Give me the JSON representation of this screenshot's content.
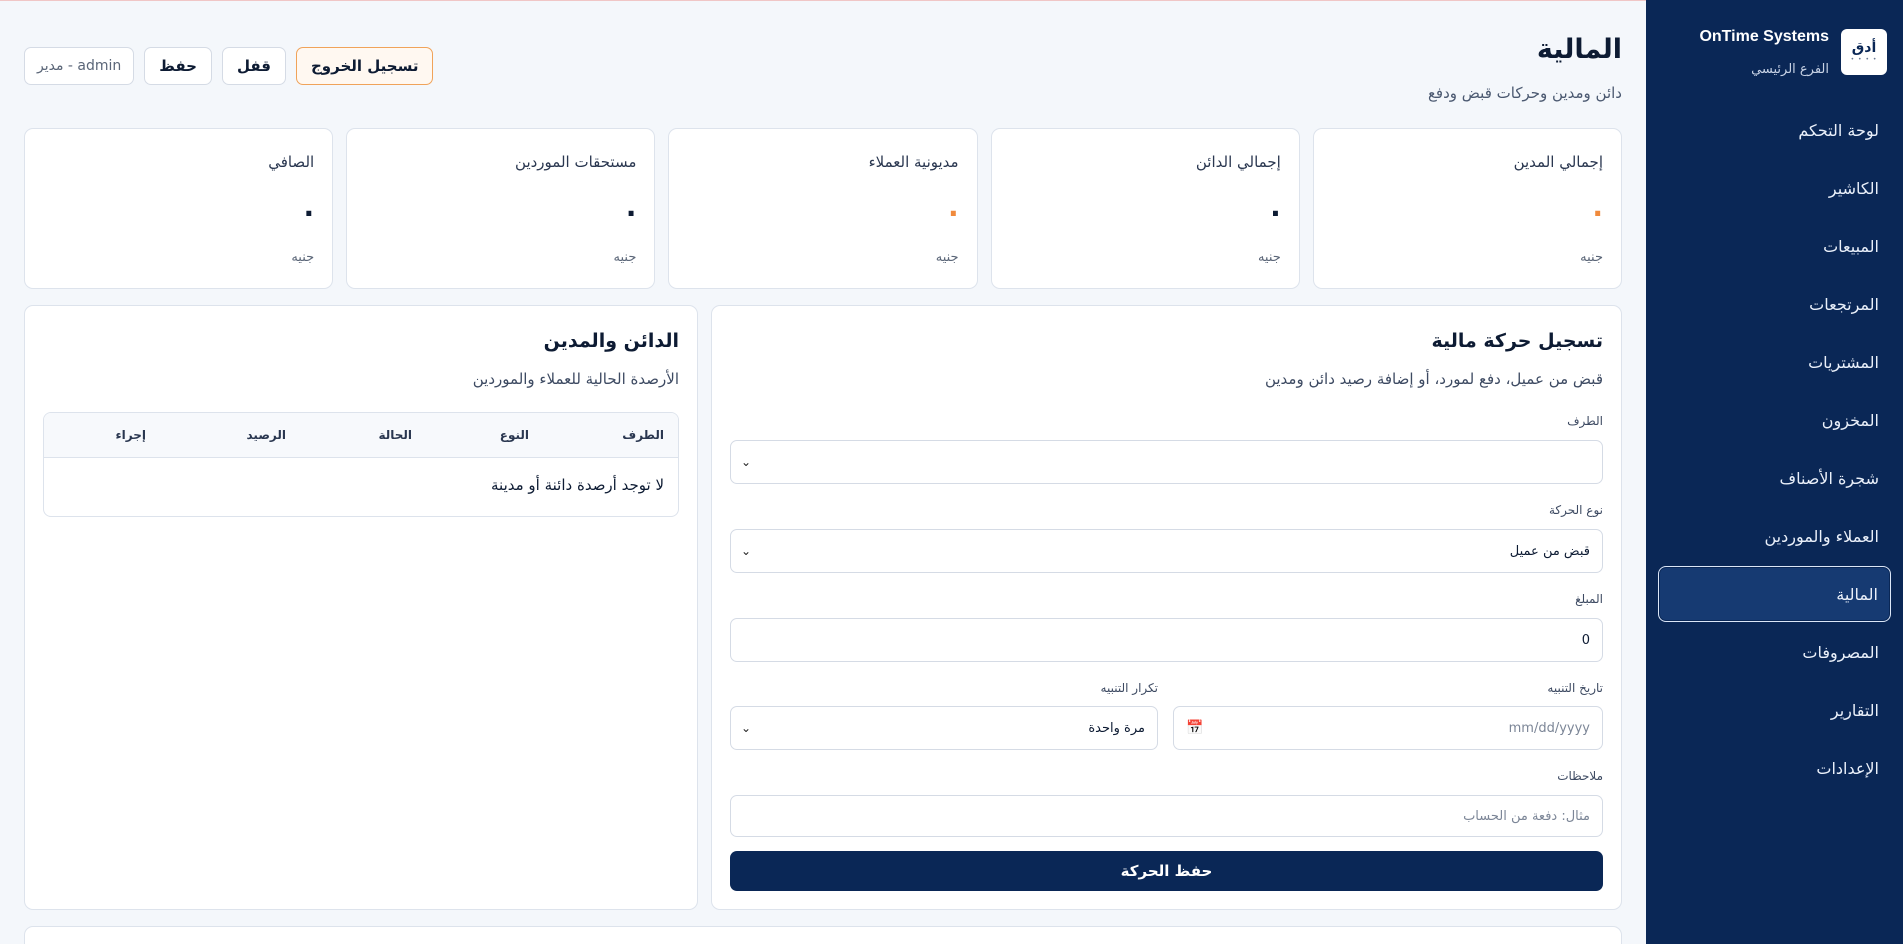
{
  "brand": {
    "name": "OnTime Systems",
    "branch": "الفرع الرئيسي",
    "logo_text": "أدق",
    "logo_dots": "• • • •"
  },
  "sidebar": {
    "items": [
      {
        "label": "لوحة التحكم"
      },
      {
        "label": "الكاشير"
      },
      {
        "label": "المبيعات"
      },
      {
        "label": "المرتجعات"
      },
      {
        "label": "المشتريات"
      },
      {
        "label": "المخزون"
      },
      {
        "label": "شجرة الأصناف"
      },
      {
        "label": "العملاء والموردين"
      },
      {
        "label": "المالية",
        "active": true
      },
      {
        "label": "المصروفات"
      },
      {
        "label": "التقارير"
      },
      {
        "label": "الإعدادات"
      }
    ]
  },
  "header": {
    "title": "المالية",
    "subtitle": "دائن ومدين وحركات قبض ودفع",
    "user": "admin - مدير",
    "save_label": "حفظ",
    "lock_label": "قفل",
    "logout_label": "تسجيل الخروج"
  },
  "stats": [
    {
      "label": "إجمالي المدين",
      "value": "·",
      "unit": "جنيه",
      "color": "#f08a3c"
    },
    {
      "label": "إجمالي الدائن",
      "value": "·",
      "unit": "جنيه",
      "color": "#0d1b33"
    },
    {
      "label": "مديونية العملاء",
      "value": "·",
      "unit": "جنيه",
      "color": "#f08a3c"
    },
    {
      "label": "مستحقات الموردين",
      "value": "·",
      "unit": "جنيه",
      "color": "#0d1b33"
    },
    {
      "label": "الصافي",
      "value": "·",
      "unit": "جنيه",
      "color": "#0d1b33"
    }
  ],
  "form": {
    "title": "تسجيل حركة مالية",
    "subtitle": "قبض من عميل، دفع لمورد، أو إضافة رصيد دائن ومدين",
    "party_label": "الطرف",
    "party_value": "",
    "type_label": "نوع الحركة",
    "type_value": "قبض من عميل",
    "amount_label": "المبلغ",
    "amount_value": "0",
    "alert_date_label": "تاريخ التنبيه",
    "alert_date_placeholder": "mm/dd/yyyy",
    "repeat_label": "تكرار التنبيه",
    "repeat_value": "مرة واحدة",
    "notes_label": "ملاحظات",
    "notes_placeholder": "مثال: دفعة من الحساب",
    "submit_label": "حفظ الحركة"
  },
  "ledger": {
    "title": "الدائن والمدين",
    "subtitle": "الأرصدة الحالية للعملاء والموردين",
    "columns": [
      "الطرف",
      "النوع",
      "الحالة",
      "الرصيد",
      "إجراء"
    ],
    "empty_text": "لا توجد أرصدة دائنة أو مدينة"
  }
}
